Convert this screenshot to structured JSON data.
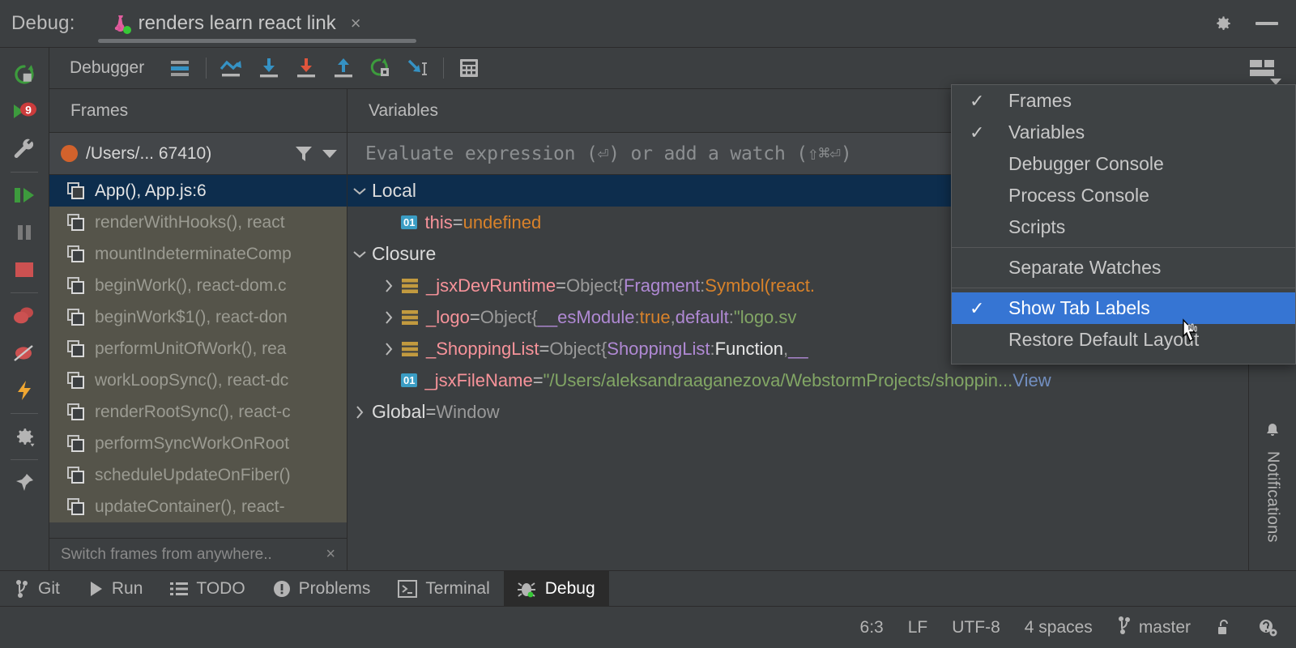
{
  "titlebar": {
    "debug_label": "Debug:",
    "tab_title": "renders learn react link",
    "close_glyph": "×",
    "gear_icon": "gear-icon",
    "minimize_icon": "minimize-icon",
    "flask_icon": "jest-flask-icon"
  },
  "left_strip": {
    "items": [
      {
        "name": "rerun-button",
        "icon": "rerun-icon"
      },
      {
        "name": "resume-program-button",
        "icon": "resume-with-count-icon",
        "badge": "9"
      },
      {
        "name": "debugger-settings-button",
        "icon": "wrench-icon"
      },
      {
        "name": "step-resume-button",
        "icon": "resume-pause-icon"
      },
      {
        "name": "pause-program-button",
        "icon": "pause-icon"
      },
      {
        "name": "stop-button",
        "icon": "stop-square-icon"
      },
      {
        "name": "view-breakpoints-button",
        "icon": "breakpoints-icon"
      },
      {
        "name": "mute-breakpoints-button",
        "icon": "mute-breakpoints-icon"
      },
      {
        "name": "evaluate-expression-button",
        "icon": "lightning-icon"
      },
      {
        "name": "settings-button",
        "icon": "gear-dropdown-icon"
      },
      {
        "name": "pin-tab-button",
        "icon": "pin-icon"
      }
    ]
  },
  "debugger_toolbar": {
    "title": "Debugger",
    "buttons": [
      {
        "name": "show-execution-point-button",
        "icon": "execution-point-icon"
      },
      {
        "name": "step-over-button",
        "icon": "step-over-icon"
      },
      {
        "name": "step-into-button",
        "icon": "step-into-icon"
      },
      {
        "name": "force-step-into-button",
        "icon": "force-step-into-icon"
      },
      {
        "name": "step-out-button",
        "icon": "step-out-icon"
      },
      {
        "name": "run-to-cursor-button",
        "icon": "run-to-cursor-icon"
      },
      {
        "name": "drop-frame-button",
        "icon": "step-into-cursor-icon"
      },
      {
        "name": "evaluate-expression-button",
        "icon": "calculator-icon"
      }
    ],
    "layout_button": {
      "name": "layout-settings-button",
      "icon": "layout-icon"
    }
  },
  "frames": {
    "header": "Frames",
    "thread": "/Users/... 67410)",
    "filter_icon": "filter-icon",
    "dropdown_icon": "chevron-down-icon",
    "hint": "Switch frames from anywhere..",
    "hint_close": "×",
    "rows": [
      {
        "label": "App(), App.js:6",
        "state": "selected"
      },
      {
        "label": "renderWithHooks(), react",
        "state": "library"
      },
      {
        "label": "mountIndeterminateComp",
        "state": "library"
      },
      {
        "label": "beginWork(), react-dom.c",
        "state": "library"
      },
      {
        "label": "beginWork$1(), react-don",
        "state": "library"
      },
      {
        "label": "performUnitOfWork(), rea",
        "state": "library"
      },
      {
        "label": "workLoopSync(), react-dc",
        "state": "library"
      },
      {
        "label": "renderRootSync(), react-c",
        "state": "library"
      },
      {
        "label": "performSyncWorkOnRoot",
        "state": "library"
      },
      {
        "label": "scheduleUpdateOnFiber()",
        "state": "library"
      },
      {
        "label": "updateContainer(), react-",
        "state": "library"
      }
    ]
  },
  "variables": {
    "header": "Variables",
    "evaluate_placeholder": "Evaluate expression (⏎) or add a watch (⇧⌘⏎)",
    "rows": [
      {
        "kind": "scope",
        "indent": 0,
        "selected": true,
        "chevron": "down",
        "name": "Local"
      },
      {
        "kind": "primitive",
        "indent": 2,
        "badge": "01",
        "name": "this",
        "eq": " = ",
        "value": "undefined",
        "value_class": "vundef"
      },
      {
        "kind": "scope",
        "indent": 0,
        "chevron": "down",
        "name": "Closure"
      },
      {
        "kind": "object",
        "indent": 1,
        "chevron": "right",
        "name": "_jsxDevRuntime",
        "eq": " = ",
        "type": "Object ",
        "parts": [
          {
            "t": "{",
            "c": "vtype"
          },
          {
            "t": "Fragment",
            "c": "vprop"
          },
          {
            "t": ": ",
            "c": "vtype"
          },
          {
            "t": "Symbol(react.",
            "c": "vnum"
          }
        ]
      },
      {
        "kind": "object",
        "indent": 1,
        "chevron": "right",
        "name": "_logo",
        "eq": " = ",
        "type": "Object ",
        "parts": [
          {
            "t": "{",
            "c": "vtype"
          },
          {
            "t": "__esModule",
            "c": "vprop"
          },
          {
            "t": ": ",
            "c": "vtype"
          },
          {
            "t": "true",
            "c": "vnum"
          },
          {
            "t": ", ",
            "c": "vtype"
          },
          {
            "t": "default",
            "c": "vprop"
          },
          {
            "t": ": ",
            "c": "vtype"
          },
          {
            "t": "\"logo.sv",
            "c": "vstr"
          }
        ]
      },
      {
        "kind": "object",
        "indent": 1,
        "chevron": "right",
        "name": "_ShoppingList",
        "eq": " = ",
        "type": "Object ",
        "parts": [
          {
            "t": "{",
            "c": "vtype"
          },
          {
            "t": "ShoppingList",
            "c": "vprop"
          },
          {
            "t": ": ",
            "c": "vtype"
          },
          {
            "t": "Function",
            "c": "vfn"
          },
          {
            "t": ", ",
            "c": "vtype"
          },
          {
            "t": "__",
            "c": "vprop"
          }
        ]
      },
      {
        "kind": "primitive",
        "indent": 2,
        "badge": "01",
        "name": "_jsxFileName",
        "eq": " = ",
        "parts": [
          {
            "t": "\"/Users/aleksandraaganezova/WebstormProjects/shoppin...",
            "c": "vstr"
          },
          {
            "t": " View",
            "c": "vlink"
          }
        ]
      },
      {
        "kind": "scope",
        "indent": 0,
        "chevron": "right",
        "name": "Global",
        "eq": " = ",
        "value": "Window",
        "value_class": "vtype"
      }
    ]
  },
  "menu": {
    "items": [
      {
        "label": "Frames",
        "checked": true,
        "highlight": false
      },
      {
        "label": "Variables",
        "checked": true,
        "highlight": false
      },
      {
        "label": "Debugger Console",
        "checked": false,
        "highlight": false
      },
      {
        "label": "Process Console",
        "checked": false,
        "highlight": false
      },
      {
        "label": "Scripts",
        "checked": false,
        "highlight": false
      },
      {
        "separator": true
      },
      {
        "label": "Separate Watches",
        "checked": false,
        "highlight": false
      },
      {
        "separator": true
      },
      {
        "label": "Show Tab Labels",
        "checked": true,
        "highlight": true
      },
      {
        "label": "Restore Default Layout",
        "checked": false,
        "highlight": false
      }
    ],
    "check_glyph": "✓"
  },
  "notifications": {
    "label": "Notifications",
    "icon": "bell-icon"
  },
  "bottom_bar": {
    "items": [
      {
        "label": "Git",
        "icon": "git-branch-icon",
        "active": false
      },
      {
        "label": "Run",
        "icon": "play-icon",
        "active": false
      },
      {
        "label": "TODO",
        "icon": "list-icon",
        "active": false
      },
      {
        "label": "Problems",
        "icon": "warning-icon",
        "active": false
      },
      {
        "label": "Terminal",
        "icon": "terminal-icon",
        "active": false
      },
      {
        "label": "Debug",
        "icon": "bug-icon",
        "active": true
      }
    ]
  },
  "status_bar": {
    "caret": "6:3",
    "line_separator": "LF",
    "encoding": "UTF-8",
    "indent": "4 spaces",
    "branch": "master",
    "branch_icon": "git-branch-icon",
    "lock_icon": "unlocked-icon",
    "inspection_icon": "inspection-icon"
  },
  "colors": {
    "accent_blue": "#3675d3",
    "selection_navy": "#0d2d4d",
    "library_frame": "#55544a",
    "thread_dot": "#d2622c",
    "string_green": "#82a665",
    "name_pink": "#f7939a",
    "number_orange": "#d8822a",
    "prop_purple": "#b089d4"
  }
}
